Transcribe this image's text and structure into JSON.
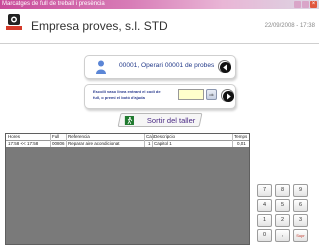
{
  "window": {
    "title": "Marcatges de full de treball i presència",
    "controls": {
      "close_glyph": "×"
    }
  },
  "header": {
    "logo_icon": "company-logo-icon",
    "company": "Empresa proves, s.l. STD",
    "datetime": "22/09/2008 - 17:38"
  },
  "operator": {
    "icon": "person-icon",
    "text": "00001, Operari 00001 de probes",
    "back_icon": "circle-left-arrow-icon"
  },
  "scan": {
    "side_icon": "pencil-icon",
    "instruction": "Escolli vaso linea entrant el codi de full, o premi el botó d'ajuda",
    "input_value": "",
    "ok_label": "ok",
    "next_icon": "circle-right-arrow-icon"
  },
  "exit": {
    "icon": "running-man-icon",
    "label": "Sortir del taller"
  },
  "table": {
    "columns": [
      "Hores",
      "Full",
      "Referencia",
      "Cap",
      "Descripcio",
      "Temps"
    ],
    "rows": [
      {
        "hores": "17:58 << 17:58",
        "full": "00806",
        "referencia": "Reparar aire acondicionat",
        "cap": "1",
        "descripcio": "Capitol 1",
        "temps": "0,01"
      }
    ]
  },
  "keypad": {
    "keys": [
      "7",
      "8",
      "9",
      "4",
      "5",
      "6",
      "1",
      "2",
      "3",
      "0",
      ",",
      "Supr"
    ]
  },
  "colors": {
    "titlebar_start": "#c94a9a",
    "accent_blue": "#243b8a",
    "table_bg": "#7a7a7a",
    "exit_green": "#1f7a2e"
  }
}
